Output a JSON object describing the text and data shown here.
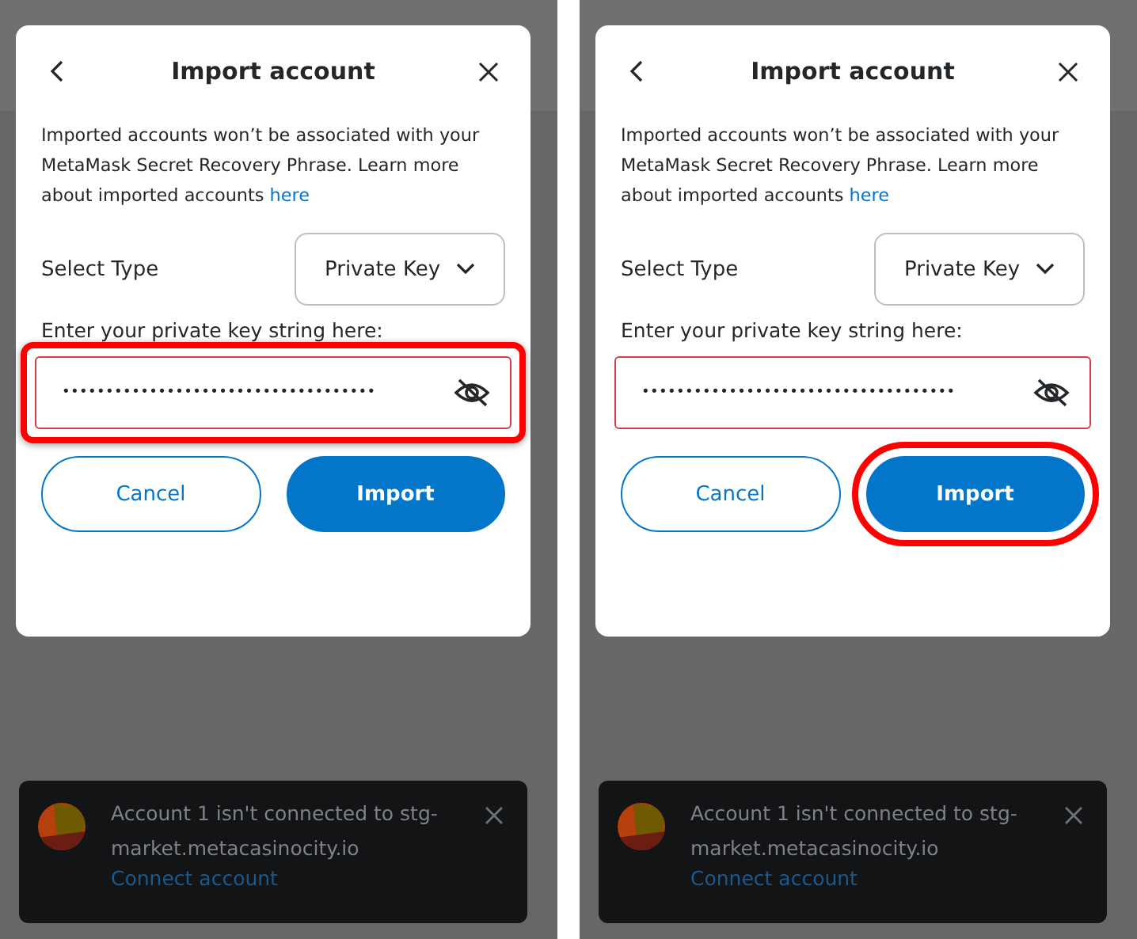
{
  "panels": [
    {
      "modal": {
        "title": "Import account",
        "description": "Imported accounts won’t be associated with your MetaMask Secret Recovery Phrase. Learn more about imported accounts",
        "link": "here",
        "select_label": "Select Type",
        "select_value": "Private Key",
        "field": {
          "label": "Enter your private key string here:",
          "masked_value": "••••••••••••••••••••••••••••••••••••",
          "highlighted": true
        },
        "buttons": [
          {
            "label": "Cancel",
            "highlighted": false
          },
          {
            "label": "Import",
            "highlighted": false
          }
        ]
      },
      "toast": {
        "message": "Account 1 isn't connected to stg-market.metacasinocity.io",
        "action": "Connect account"
      }
    },
    {
      "modal": {
        "title": "Import account",
        "description": "Imported accounts won’t be associated with your MetaMask Secret Recovery Phrase. Learn more about imported accounts",
        "link": "here",
        "select_label": "Select Type",
        "select_value": "Private Key",
        "field": {
          "label": "Enter your private key string here:",
          "masked_value": "••••••••••••••••••••••••••••••••••••",
          "highlighted": false
        },
        "buttons": [
          {
            "label": "Cancel",
            "highlighted": false
          },
          {
            "label": "Import",
            "highlighted": true
          }
        ]
      },
      "toast": {
        "message": "Account 1 isn't connected to stg-market.metacasinocity.io",
        "action": "Connect account"
      }
    }
  ]
}
